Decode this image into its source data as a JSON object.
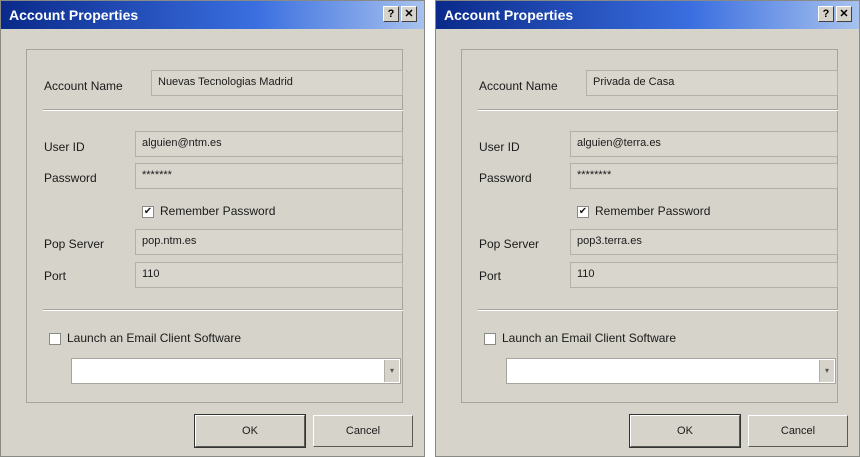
{
  "dialogs": [
    {
      "title": "Account Properties",
      "help_label": "?",
      "close_label": "✕",
      "account_name_label": "Account Name",
      "account_name": "Nuevas Tecnologias Madrid",
      "user_id_label": "User ID",
      "user_id": "alguien@ntm.es",
      "password_label": "Password",
      "password": "*******",
      "remember_label": "Remember Password",
      "remember_checked": "✔",
      "pop_server_label": "Pop Server",
      "pop_server": "pop.ntm.es",
      "port_label": "Port",
      "port": "110",
      "launch_label": "Launch an Email Client Software",
      "client_value": "",
      "ok_label": "OK",
      "cancel_label": "Cancel"
    },
    {
      "title": "Account Properties",
      "help_label": "?",
      "close_label": "✕",
      "account_name_label": "Account Name",
      "account_name": "Privada de Casa",
      "user_id_label": "User ID",
      "user_id": "alguien@terra.es",
      "password_label": "Password",
      "password": "********",
      "remember_label": "Remember Password",
      "remember_checked": "✔",
      "pop_server_label": "Pop Server",
      "pop_server": "pop3.terra.es",
      "port_label": "Port",
      "port": "110",
      "launch_label": "Launch an Email Client Software",
      "client_value": "",
      "ok_label": "OK",
      "cancel_label": "Cancel"
    }
  ]
}
